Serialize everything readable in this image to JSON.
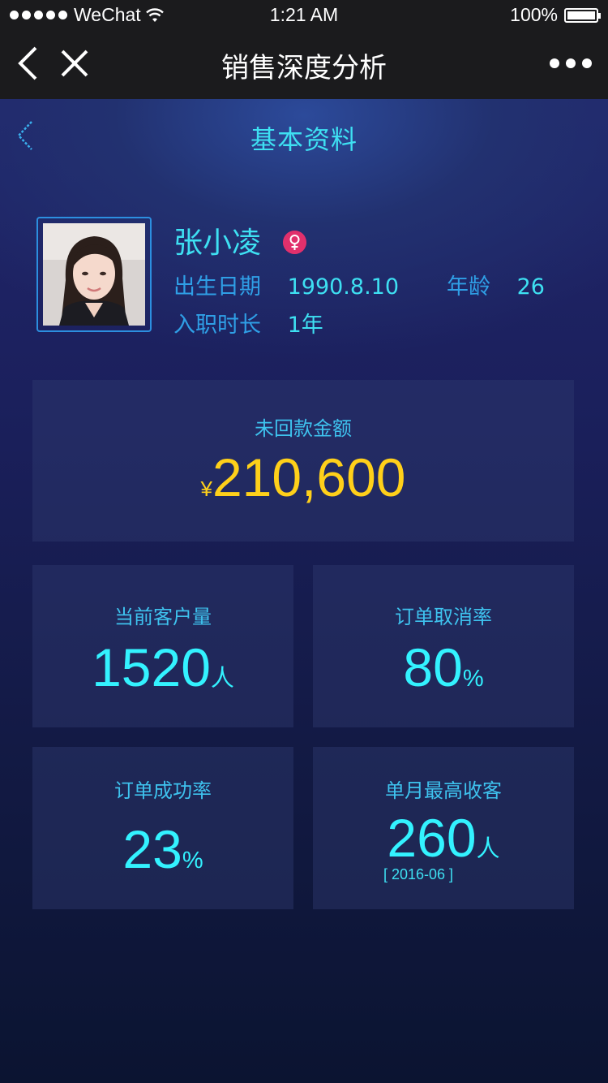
{
  "status_bar": {
    "carrier": "WeChat",
    "time": "1:21 AM",
    "battery": "100%"
  },
  "nav": {
    "title": "销售深度分析"
  },
  "sub_header": {
    "title": "基本资料"
  },
  "profile": {
    "name": "张小凌",
    "gender": "female",
    "birth_label": "出生日期",
    "birth_value": "1990.8.10",
    "age_label": "年龄",
    "age_value": "26",
    "tenure_label": "入职时长",
    "tenure_value": "1年"
  },
  "unpaid": {
    "label": "未回款金额",
    "currency": "¥",
    "amount": "210,600"
  },
  "stats": [
    {
      "label": "当前客户量",
      "value": "1520",
      "unit": "人"
    },
    {
      "label": "订单取消率",
      "value": "80",
      "unit": "%"
    },
    {
      "label": "订单成功率",
      "value": "23",
      "unit": "%"
    },
    {
      "label": "单月最高收客",
      "value": "260",
      "unit": "人",
      "date": "[ 2016-06 ]"
    }
  ],
  "colors": {
    "accent_cyan": "#3ee0f2",
    "label_blue": "#2f9fe6",
    "money_yellow": "#ffd01a",
    "gender_pink": "#e1306c"
  },
  "icons": {
    "nav_back": "chevron-left-icon",
    "nav_close": "close-icon",
    "nav_more": "more-dots-icon",
    "sub_back": "chevron-left-icon",
    "gender": "female-icon"
  }
}
